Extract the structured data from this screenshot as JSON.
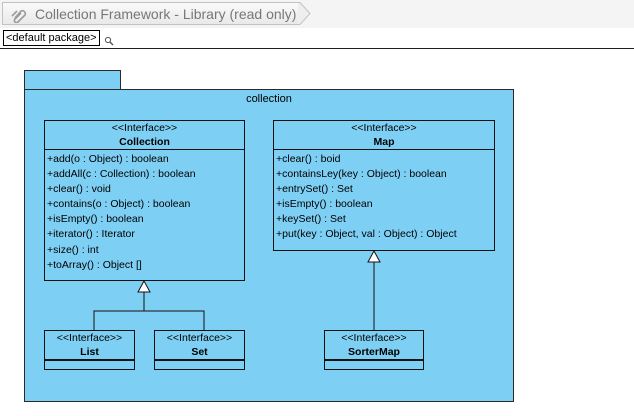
{
  "window": {
    "title": "Collection Framework - Library (read only)",
    "title_icon": "paperclip-icon"
  },
  "breadcrumb": {
    "package": "<default package>",
    "search_icon": "magnifier-icon"
  },
  "diagram": {
    "package_name": "collection",
    "package_color": "#7ecff4",
    "classes": {
      "collection": {
        "stereotype": "<<Interface>>",
        "name": "Collection",
        "operations": [
          "+add(o : Object) : boolean",
          "+addAll(c : Collection) : boolean",
          "+clear() : void",
          "+contains(o : Object) : boolean",
          "+isEmpty() : boolean",
          "+iterator() : Iterator",
          "+size() : int",
          "+toArray() : Object []"
        ]
      },
      "map": {
        "stereotype": "<<Interface>>",
        "name": "Map",
        "operations": [
          "+clear() : boid",
          "+containsLey(key : Object) : boolean",
          "+entrySet() : Set",
          "+isEmpty() : boolean",
          "+keySet() : Set",
          "+put(key : Object, val : Object) : Object"
        ]
      },
      "list": {
        "stereotype": "<<Interface>>",
        "name": "List"
      },
      "set": {
        "stereotype": "<<Interface>>",
        "name": "Set"
      },
      "sortermap": {
        "stereotype": "<<Interface>>",
        "name": "SorterMap"
      }
    }
  }
}
